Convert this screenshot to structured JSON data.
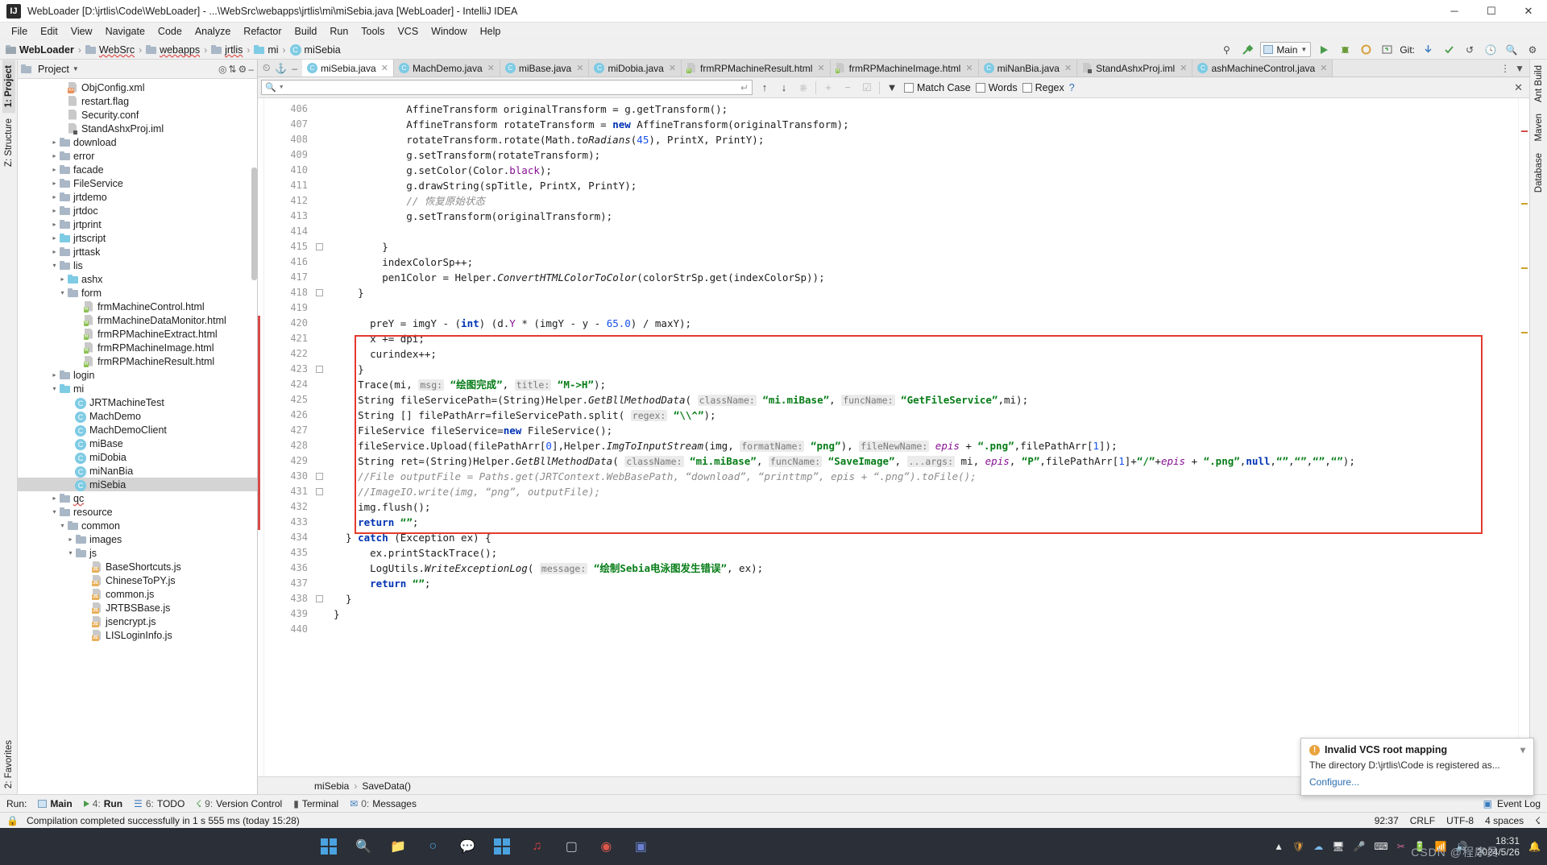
{
  "window": {
    "title": "WebLoader [D:\\jrtlis\\Code\\WebLoader] - ...\\WebSrc\\webapps\\jrtlis\\mi\\miSebia.java [WebLoader] - IntelliJ IDEA",
    "app_icon": "IJ",
    "minimize": "─",
    "maximize": "☐",
    "close": "✕"
  },
  "menu": [
    "File",
    "Edit",
    "View",
    "Navigate",
    "Code",
    "Analyze",
    "Refactor",
    "Build",
    "Run",
    "Tools",
    "VCS",
    "Window",
    "Help"
  ],
  "breadcrumb": [
    {
      "label": "WebLoader",
      "icon": "module-icon",
      "bold": true
    },
    {
      "label": "WebSrc",
      "icon": "folder-icon",
      "bold": false
    },
    {
      "label": "webapps",
      "icon": "folder-icon",
      "bold": false
    },
    {
      "label": "jrtlis",
      "icon": "folder-icon",
      "bold": false
    },
    {
      "label": "mi",
      "icon": "folder-blue-icon",
      "bold": false
    },
    {
      "label": "miSebia",
      "icon": "class-icon",
      "bold": false
    }
  ],
  "toolbar": {
    "run_config": "Main",
    "git_label": "Git:",
    "icons": [
      "search-everywhere-icon",
      "hammer-build-icon",
      "run-icon",
      "debug-icon",
      "run-with-coverage-icon",
      "profiler-icon",
      "update-project-icon",
      "commit-icon",
      "rollback-icon",
      "history-icon",
      "search-icon",
      "settings-icon"
    ]
  },
  "left_rail": {
    "top": [
      "1: Project",
      "Z: Structure"
    ],
    "bottom": [
      "2: Favorites"
    ]
  },
  "right_rail": {
    "items": [
      "Ant Build",
      "Maven",
      "Database"
    ]
  },
  "project_panel": {
    "title": "Project",
    "header_icons": [
      "collapse-all-icon",
      "expand-all-icon",
      "settings-icon",
      "hide-icon"
    ],
    "tree": [
      {
        "label": "ObjConfig.xml",
        "indent": 5,
        "arrow": "",
        "icon": "xml",
        "badge": "<>"
      },
      {
        "label": "restart.flag",
        "indent": 5,
        "arrow": "",
        "icon": "txt",
        "badge": ""
      },
      {
        "label": "Security.conf",
        "indent": 5,
        "arrow": "",
        "icon": "txt",
        "badge": ""
      },
      {
        "label": "StandAshxProj.iml",
        "indent": 5,
        "arrow": "",
        "icon": "iml",
        "badge": ""
      },
      {
        "label": "download",
        "indent": 4,
        "arrow": "›",
        "icon": "folder",
        "badge": ""
      },
      {
        "label": "error",
        "indent": 4,
        "arrow": "›",
        "icon": "folder",
        "badge": ""
      },
      {
        "label": "facade",
        "indent": 4,
        "arrow": "›",
        "icon": "folder",
        "badge": ""
      },
      {
        "label": "FileService",
        "indent": 4,
        "arrow": "›",
        "icon": "folder",
        "badge": ""
      },
      {
        "label": "jrtdemo",
        "indent": 4,
        "arrow": "›",
        "icon": "folder",
        "badge": ""
      },
      {
        "label": "jrtdoc",
        "indent": 4,
        "arrow": "›",
        "icon": "folder",
        "badge": ""
      },
      {
        "label": "jrtprint",
        "indent": 4,
        "arrow": "›",
        "icon": "folder",
        "badge": ""
      },
      {
        "label": "jrtscript",
        "indent": 4,
        "arrow": "›",
        "icon": "folder-blue",
        "badge": ""
      },
      {
        "label": "jrttask",
        "indent": 4,
        "arrow": "›",
        "icon": "folder",
        "badge": ""
      },
      {
        "label": "lis",
        "indent": 4,
        "arrow": "∨",
        "icon": "folder",
        "badge": ""
      },
      {
        "label": "ashx",
        "indent": 5,
        "arrow": "›",
        "icon": "folder-blue",
        "badge": ""
      },
      {
        "label": "form",
        "indent": 5,
        "arrow": "∨",
        "icon": "folder",
        "badge": ""
      },
      {
        "label": "frmMachineControl.html",
        "indent": 7,
        "arrow": "",
        "icon": "html",
        "badge": "H"
      },
      {
        "label": "frmMachineDataMonitor.html",
        "indent": 7,
        "arrow": "",
        "icon": "html",
        "badge": "H"
      },
      {
        "label": "frmRPMachineExtract.html",
        "indent": 7,
        "arrow": "",
        "icon": "html",
        "badge": "H"
      },
      {
        "label": "frmRPMachineImage.html",
        "indent": 7,
        "arrow": "",
        "icon": "html",
        "badge": "H"
      },
      {
        "label": "frmRPMachineResult.html",
        "indent": 7,
        "arrow": "",
        "icon": "html",
        "badge": "H"
      },
      {
        "label": "login",
        "indent": 4,
        "arrow": "›",
        "icon": "folder",
        "badge": ""
      },
      {
        "label": "mi",
        "indent": 4,
        "arrow": "∨",
        "icon": "folder-blue",
        "badge": ""
      },
      {
        "label": "JRTMachineTest",
        "indent": 6,
        "arrow": "",
        "icon": "class",
        "badge": "C"
      },
      {
        "label": "MachDemo",
        "indent": 6,
        "arrow": "",
        "icon": "class",
        "badge": "C"
      },
      {
        "label": "MachDemoClient",
        "indent": 6,
        "arrow": "",
        "icon": "class",
        "badge": "C"
      },
      {
        "label": "miBase",
        "indent": 6,
        "arrow": "",
        "icon": "class",
        "badge": "C"
      },
      {
        "label": "miDobia",
        "indent": 6,
        "arrow": "",
        "icon": "class",
        "badge": "C"
      },
      {
        "label": "miNanBia",
        "indent": 6,
        "arrow": "",
        "icon": "class",
        "badge": "C"
      },
      {
        "label": "miSebia",
        "indent": 6,
        "arrow": "",
        "icon": "class",
        "badge": "C",
        "selected": true
      },
      {
        "label": "qc",
        "indent": 4,
        "arrow": "›",
        "icon": "folder",
        "badge": ""
      },
      {
        "label": "resource",
        "indent": 4,
        "arrow": "∨",
        "icon": "folder",
        "badge": ""
      },
      {
        "label": "common",
        "indent": 5,
        "arrow": "∨",
        "icon": "folder",
        "badge": ""
      },
      {
        "label": "images",
        "indent": 6,
        "arrow": "›",
        "icon": "folder",
        "badge": ""
      },
      {
        "label": "js",
        "indent": 6,
        "arrow": "∨",
        "icon": "folder",
        "badge": ""
      },
      {
        "label": "BaseShortcuts.js",
        "indent": 8,
        "arrow": "",
        "icon": "js",
        "badge": "JS"
      },
      {
        "label": "ChineseToPY.js",
        "indent": 8,
        "arrow": "",
        "icon": "js",
        "badge": "JS"
      },
      {
        "label": "common.js",
        "indent": 8,
        "arrow": "",
        "icon": "js",
        "badge": "JS"
      },
      {
        "label": "JRTBSBase.js",
        "indent": 8,
        "arrow": "",
        "icon": "js",
        "badge": "JS"
      },
      {
        "label": "jsencrypt.js",
        "indent": 8,
        "arrow": "",
        "icon": "js",
        "badge": "JS"
      },
      {
        "label": "LISLoginInfo.js",
        "indent": 8,
        "arrow": "",
        "icon": "js",
        "badge": "JS"
      }
    ]
  },
  "editor_tabs": [
    {
      "label": "miSebia.java",
      "icon": "class",
      "active": true
    },
    {
      "label": "MachDemo.java",
      "icon": "class",
      "active": false
    },
    {
      "label": "miBase.java",
      "icon": "class",
      "active": false
    },
    {
      "label": "miDobia.java",
      "icon": "class",
      "active": false
    },
    {
      "label": "frmRPMachineResult.html",
      "icon": "html",
      "active": false
    },
    {
      "label": "frmRPMachineImage.html",
      "icon": "html",
      "active": false
    },
    {
      "label": "miNanBia.java",
      "icon": "class",
      "active": false
    },
    {
      "label": "StandAshxProj.iml",
      "icon": "iml",
      "active": false
    },
    {
      "label": "ashMachineControl.java",
      "icon": "class",
      "active": false
    }
  ],
  "find_bar": {
    "placeholder": "",
    "value": "",
    "search_icon": "search-icon",
    "options": [
      {
        "label": "Match Case",
        "checked": false
      },
      {
        "label": "Words",
        "checked": false
      },
      {
        "label": "Regex",
        "checked": false
      }
    ],
    "help": "?",
    "close": "✕",
    "nav_icons": [
      "find-previous-icon",
      "find-next-icon",
      "select-all-icon",
      "add-selection-icon",
      "remove-selection-icon",
      "select-occurrences-icon",
      "filter-icon"
    ]
  },
  "code": {
    "first_line": 406,
    "lines": [
      {
        "n": 406,
        "html": "            AffineTransform originalTransform = g.getTransform();"
      },
      {
        "n": 407,
        "html": "            AffineTransform rotateTransform = <k>new</k> AffineTransform(originalTransform);"
      },
      {
        "n": 408,
        "html": "            rotateTransform.rotate(Math.<m>toRadians</m>(<d>45</d>), PrintX, PrintY);"
      },
      {
        "n": 409,
        "html": "            g.setTransform(rotateTransform);"
      },
      {
        "n": 410,
        "html": "            g.setColor(Color.<f>black</f>);"
      },
      {
        "n": 411,
        "html": "            g.drawString(spTitle, PrintX, PrintY);"
      },
      {
        "n": 412,
        "html": "            <c>// 恢复原始状态</c>"
      },
      {
        "n": 413,
        "html": "            g.setTransform(originalTransform);"
      },
      {
        "n": 414,
        "html": ""
      },
      {
        "n": 415,
        "html": "        }"
      },
      {
        "n": 416,
        "html": "        indexColorSp++;"
      },
      {
        "n": 417,
        "html": "        pen1Color = Helper.<m>ConvertHTMLColorToColor</m>(colorStrSp.get(indexColorSp));"
      },
      {
        "n": 418,
        "html": "    }"
      },
      {
        "n": 419,
        "html": ""
      },
      {
        "n": 420,
        "html": "      preY = imgY - (<k>int</k>) (d.<f>Y</f> * (imgY - y - <d>65.0</d>) / maxY);"
      },
      {
        "n": 421,
        "html": "      x += dpi;"
      },
      {
        "n": 422,
        "html": "      curindex++;"
      },
      {
        "n": 423,
        "html": "    }"
      },
      {
        "n": 424,
        "html": "    Trace(mi, <h>msg:</h> <s>“绘图完成”</s>, <h>title:</h> <s>“M-&gt;H”</s>);"
      },
      {
        "n": 425,
        "html": "    String fileServicePath=(String)Helper.<m>GetBllMethodData</m>( <h>className:</h> <s>“mi.miBase”</s>, <h>funcName:</h> <s>“GetFileService”</s>,mi);"
      },
      {
        "n": 426,
        "html": "    String [] filePathArr=fileServicePath.split( <h>regex:</h> <s>“\\\\^”</s>);"
      },
      {
        "n": 427,
        "html": "    FileService fileService=<k>new</k> FileService();"
      },
      {
        "n": 428,
        "html": "    fileService.Upload(filePathArr[<d>0</d>],Helper.<m>ImgToInputStream</m>(img, <h>formatName:</h> <s>“png”</s>), <h>fileNewName:</h> <i>epis</i> + <s>“.png”</s>,filePathArr[<d>1</d>]);"
      },
      {
        "n": 429,
        "html": "    String ret=(String)Helper.<m>GetBllMethodData</m>( <h>className:</h> <s>“mi.miBase”</s>, <h>funcName:</h> <s>“SaveImage”</s>, <h>...args:</h> mi, <i>epis</i>, <s>“P”</s>,filePathArr[<d>1</d>]+<s>“/”</s>+<i>epis</i> + <s>“.png”</s>,<k>null</k>,<s>“”</s>,<s>“”</s>,<s>“”</s>,<s>“”</s>);"
      },
      {
        "n": 430,
        "html": "    <c>//File outputFile = Paths.get(JRTContext.WebBasePath, “download”, “printtmp”, epis + “.png”).toFile();</c>"
      },
      {
        "n": 431,
        "html": "    <c>//ImageIO.write(img, “png”, outputFile);</c>"
      },
      {
        "n": 432,
        "html": "    img.flush();"
      },
      {
        "n": 433,
        "html": "    <k>return</k> <s>“”</s>;"
      },
      {
        "n": 434,
        "html": "  } <k>catch</k> (Exception ex) {"
      },
      {
        "n": 435,
        "html": "      ex.printStackTrace();"
      },
      {
        "n": 436,
        "html": "      LogUtils.<m>WriteExceptionLog</m>( <h>message:</h> <s>“绘制Sebia电泳图发生错误”</s>, ex);"
      },
      {
        "n": 437,
        "html": "      <k>return</k> <s>“”</s>;"
      },
      {
        "n": 438,
        "html": "  }"
      },
      {
        "n": 439,
        "html": "}"
      },
      {
        "n": 440,
        "html": ""
      }
    ],
    "annotation_box_color": "#e33b2e",
    "annotation_lines": "421-433"
  },
  "method_bar": {
    "class": "miSebia",
    "method": "SaveData()",
    "separator": "›"
  },
  "bottom_bar": {
    "run_label": "Run:",
    "items": [
      {
        "label": "Main",
        "active": true
      },
      {
        "num": "4:",
        "label": "Run"
      },
      {
        "num": "6:",
        "label": "TODO"
      },
      {
        "num": "9:",
        "label": "Version Control"
      },
      {
        "num": "",
        "label": "Terminal"
      },
      {
        "num": "0:",
        "label": "Messages"
      }
    ],
    "event_log": "Event Log"
  },
  "status_bar": {
    "message": "Compilation completed successfully in 1 s 555 ms (today 15:28)",
    "position": "92:37",
    "line_sep": "CRLF",
    "encoding": "UTF-8",
    "indent": "4 spaces",
    "lock_icon": "lock-icon"
  },
  "notification": {
    "title": "Invalid VCS root mapping",
    "body": "The directory D:\\jrtlis\\Code is registered as...",
    "link": "Configure...",
    "icon": "warning-icon"
  },
  "taskbar": {
    "start": "windows-start-icon",
    "items": [
      "start-icon",
      "search-icon",
      "folder-icon",
      "edge-icon",
      "wechat-icon",
      "widgets-icon",
      "qq-icon",
      "music-icon",
      "app-icon",
      "chrome-icon",
      "teams-icon"
    ],
    "tray": [
      "chevron-up-icon",
      "shield-icon",
      "cloud-icon",
      "monitor-icon",
      "mic-icon",
      "keyboard-icon",
      "snip-icon",
      "battery-icon",
      "network-icon",
      "volume-icon"
    ],
    "time": "18:31",
    "date": "2024/5/26",
    "watermark": "CSDN @程序员"
  }
}
